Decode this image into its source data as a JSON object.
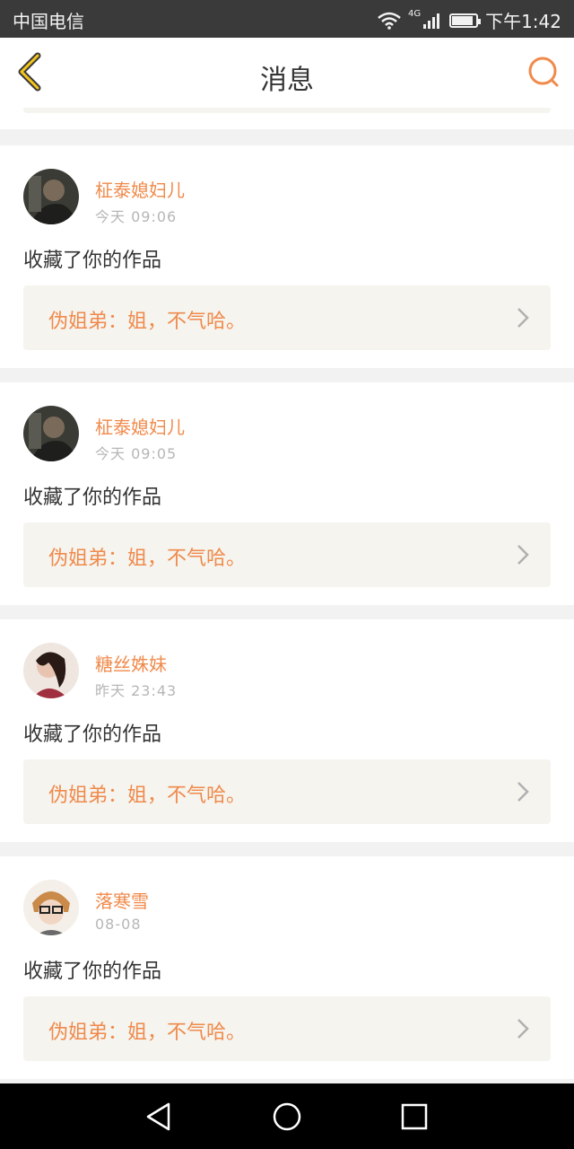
{
  "status_bar": {
    "carrier": "中国电信",
    "network": "4G",
    "time": "下午1:42",
    "battery_level": 0.9
  },
  "header": {
    "title": "消息",
    "back_icon": "chevron-left-icon",
    "search_icon": "search-icon",
    "accent_color": "#f08a4b"
  },
  "messages": [
    {
      "username": "柾泰媳妇儿",
      "time": "今天 09:06",
      "action": "收藏了你的作品",
      "quote": "伪姐弟：姐，不气哈。"
    },
    {
      "username": "柾泰媳妇儿",
      "time": "今天 09:05",
      "action": "收藏了你的作品",
      "quote": "伪姐弟：姐，不气哈。"
    },
    {
      "username": "糖丝姝妹",
      "time": "昨天 23:43",
      "action": "收藏了你的作品",
      "quote": "伪姐弟：姐，不气哈。"
    },
    {
      "username": "落寒雪",
      "time": "08-08",
      "action": "收藏了你的作品",
      "quote": "伪姐弟：姐，不气哈。"
    }
  ],
  "nav_bar": {
    "back_icon": "triangle-back-icon",
    "home_icon": "circle-home-icon",
    "recents_icon": "square-recents-icon"
  }
}
